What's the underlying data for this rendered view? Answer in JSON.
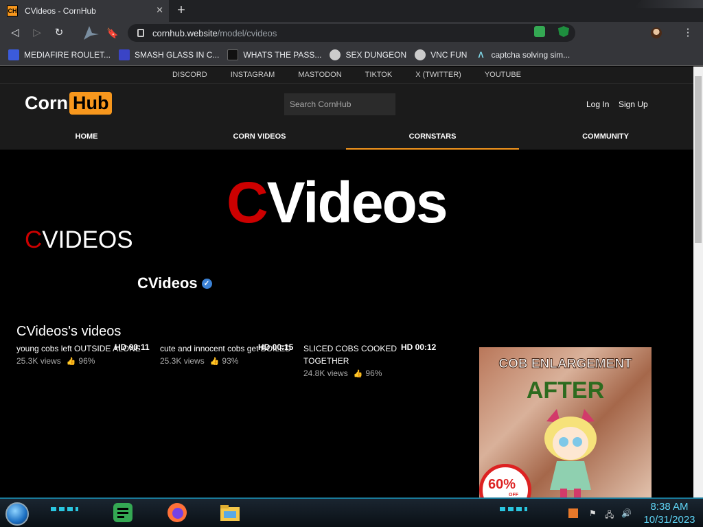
{
  "browser": {
    "tab": {
      "favicon": "CH",
      "title": "CVideos - CornHub"
    },
    "address": {
      "host": "cornhub.website",
      "path": "/model/cvideos"
    },
    "bookmarks": [
      {
        "label": "MEDIAFIRE ROULET...",
        "icon_color": "#3b5bdb"
      },
      {
        "label": "SMASH GLASS IN C...",
        "icon_color": "#3a44c6"
      },
      {
        "label": "WHATS THE PASS...",
        "icon_color": "#222222"
      },
      {
        "label": "SEX DUNGEON",
        "icon_color": "#dddddd"
      },
      {
        "label": "VNC FUN",
        "icon_color": "#dddddd"
      },
      {
        "label": "captcha solving sim...",
        "icon_color": "#7fd6e6"
      }
    ]
  },
  "site": {
    "social_links": [
      "DISCORD",
      "INSTAGRAM",
      "MASTODON",
      "TIKTOK",
      "X (TWITTER)",
      "YOUTUBE"
    ],
    "logo": {
      "part1": "Corn",
      "part2": "Hub"
    },
    "search_placeholder": "Search CornHub",
    "login": "Log In",
    "signup": "Sign Up",
    "menu": [
      "HOME",
      "CORN VIDEOS",
      "CORNSTARS",
      "COMMUNITY"
    ],
    "active_menu": "CORNSTARS",
    "accent_color": "#f7971d"
  },
  "model": {
    "hero": {
      "first": "C",
      "rest": "Videos"
    },
    "side_brand": {
      "first": "C",
      "rest": "VIDEOS"
    },
    "name": "CVideos",
    "videos_heading": "CVideos's videos",
    "videos": [
      {
        "title": "young cobs left OUTSIDE ALONE",
        "hd": "HD 00:11",
        "views": "25.3K views",
        "rating": "96%"
      },
      {
        "title": "cute and innocent cobs get BOILED",
        "hd": "HD 00:15",
        "views": "25.3K views",
        "rating": "93%"
      },
      {
        "title": "SLICED COBS COOKED TOGETHER",
        "hd": "HD 00:12",
        "views": "24.8K views",
        "rating": "96%"
      }
    ],
    "ad": {
      "line1": "COB ENLARGEMENT",
      "line2": "AFTER",
      "badge": "60%",
      "badge_sub": "OFF"
    }
  },
  "taskbar": {
    "time": "8:38 AM",
    "date": "10/31/2023"
  }
}
